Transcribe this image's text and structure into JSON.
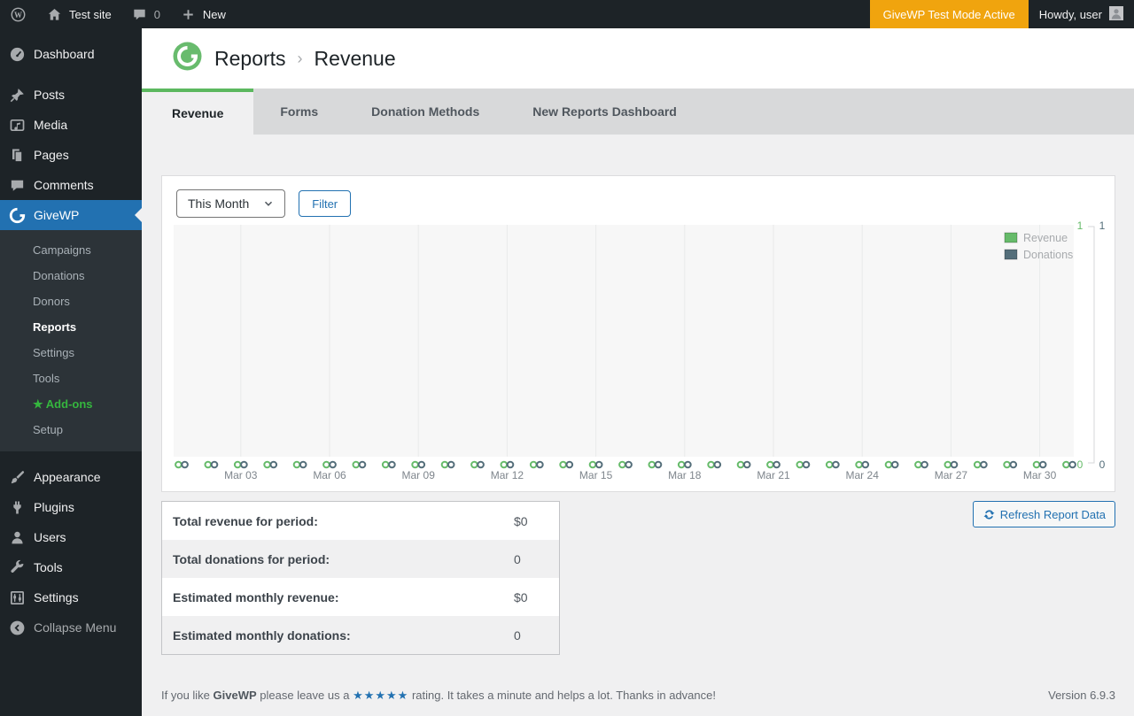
{
  "admin_bar": {
    "site_name": "Test site",
    "comments_count": "0",
    "new_label": "New",
    "test_mode_badge": "GiveWP Test Mode Active",
    "howdy": "Howdy, user",
    "badge_bg": "#f0a40e"
  },
  "sidebar": {
    "items": [
      {
        "label": "Dashboard",
        "icon": "dashboard-icon"
      },
      {
        "label": "Posts",
        "icon": "pin-icon",
        "gap_before": true
      },
      {
        "label": "Media",
        "icon": "media-icon"
      },
      {
        "label": "Pages",
        "icon": "pages-icon"
      },
      {
        "label": "Comments",
        "icon": "comments-icon"
      },
      {
        "label": "GiveWP",
        "icon": "givewp-icon",
        "active": true,
        "submenu": [
          {
            "label": "Campaigns"
          },
          {
            "label": "Donations"
          },
          {
            "label": "Donors"
          },
          {
            "label": "Reports",
            "current": true
          },
          {
            "label": "Settings"
          },
          {
            "label": "Tools"
          },
          {
            "label": "Add-ons",
            "highlight": true,
            "star": true
          },
          {
            "label": "Setup"
          }
        ]
      },
      {
        "label": "Appearance",
        "icon": "appearance-icon",
        "gap_before": true
      },
      {
        "label": "Plugins",
        "icon": "plugins-icon"
      },
      {
        "label": "Users",
        "icon": "users-icon"
      },
      {
        "label": "Tools",
        "icon": "tools-icon"
      },
      {
        "label": "Settings",
        "icon": "settings-icon"
      },
      {
        "label": "Collapse Menu",
        "icon": "collapse-icon",
        "muted": true
      }
    ]
  },
  "header": {
    "breadcrumb_section": "Reports",
    "breadcrumb_sep": "›",
    "breadcrumb_page": "Revenue",
    "logo_green": "#68bb6d"
  },
  "tabs": [
    {
      "label": "Revenue",
      "active": true
    },
    {
      "label": "Forms"
    },
    {
      "label": "Donation Methods"
    },
    {
      "label": "New Reports Dashboard"
    }
  ],
  "filter": {
    "period_value": "This Month",
    "filter_button": "Filter"
  },
  "chart_data": {
    "type": "line",
    "title": "",
    "xlabel": "",
    "ylabel": "",
    "categories": [
      "Mar 01",
      "Mar 02",
      "Mar 03",
      "Mar 04",
      "Mar 05",
      "Mar 06",
      "Mar 07",
      "Mar 08",
      "Mar 09",
      "Mar 10",
      "Mar 11",
      "Mar 12",
      "Mar 13",
      "Mar 14",
      "Mar 15",
      "Mar 16",
      "Mar 17",
      "Mar 18",
      "Mar 19",
      "Mar 20",
      "Mar 21",
      "Mar 22",
      "Mar 23",
      "Mar 24",
      "Mar 25",
      "Mar 26",
      "Mar 27",
      "Mar 28",
      "Mar 29",
      "Mar 30",
      "Mar 31"
    ],
    "x_tick_labels": [
      "Mar 03",
      "Mar 06",
      "Mar 09",
      "Mar 12",
      "Mar 15",
      "Mar 18",
      "Mar 21",
      "Mar 24",
      "Mar 27",
      "Mar 30"
    ],
    "series": [
      {
        "name": "Revenue",
        "color": "#66bb6a",
        "axis": "left",
        "values": [
          0,
          0,
          0,
          0,
          0,
          0,
          0,
          0,
          0,
          0,
          0,
          0,
          0,
          0,
          0,
          0,
          0,
          0,
          0,
          0,
          0,
          0,
          0,
          0,
          0,
          0,
          0,
          0,
          0,
          0,
          0
        ]
      },
      {
        "name": "Donations",
        "color": "#546e7a",
        "axis": "right",
        "values": [
          0,
          0,
          0,
          0,
          0,
          0,
          0,
          0,
          0,
          0,
          0,
          0,
          0,
          0,
          0,
          0,
          0,
          0,
          0,
          0,
          0,
          0,
          0,
          0,
          0,
          0,
          0,
          0,
          0,
          0,
          0
        ]
      }
    ],
    "ylim": [
      0,
      1
    ],
    "yticks": [
      0,
      1
    ],
    "legend_position": "top-right",
    "grid": "vertical lines every 3 days",
    "plot_bg": "#f7f7f7"
  },
  "summary_table": {
    "rows": [
      {
        "label": "Total revenue for period:",
        "value": "$0"
      },
      {
        "label": "Total donations for period:",
        "value": "0"
      },
      {
        "label": "Estimated monthly revenue:",
        "value": "$0"
      },
      {
        "label": "Estimated monthly donations:",
        "value": "0"
      }
    ]
  },
  "refresh_button": "Refresh Report Data",
  "footer": {
    "rating_prefix": "If you like ",
    "plugin_name": "GiveWP",
    "rating_mid": " please leave us a ",
    "stars": "★★★★★",
    "rating_suffix": " rating. It takes a minute and helps a lot. Thanks in advance!",
    "version": "Version 6.9.3"
  }
}
